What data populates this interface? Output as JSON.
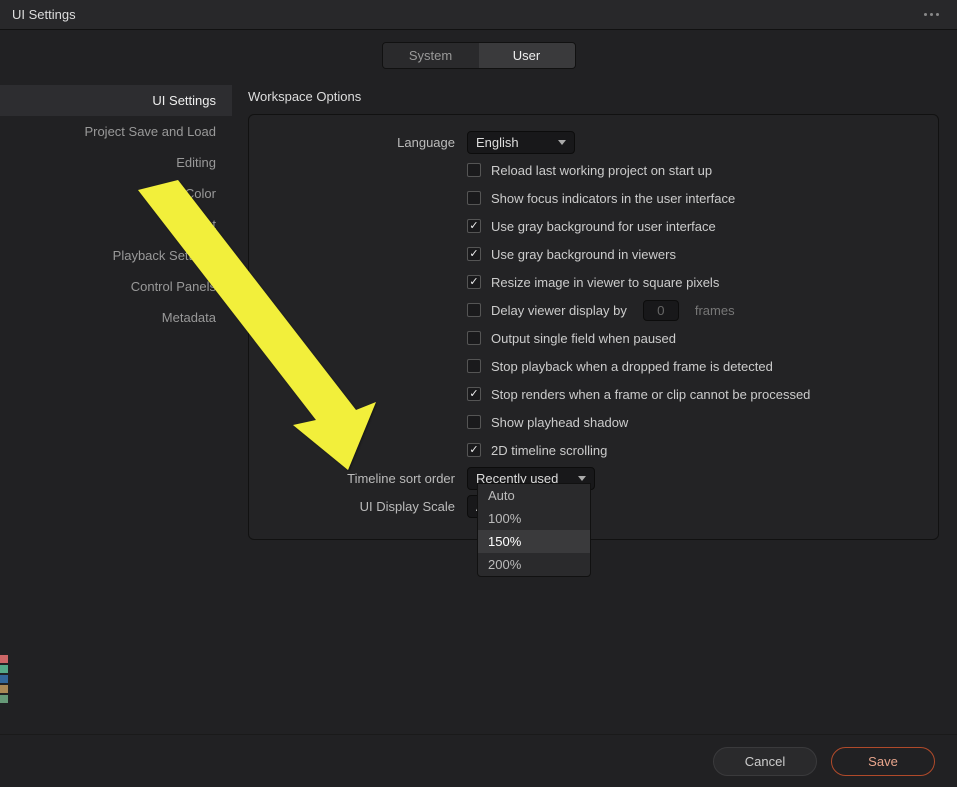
{
  "window_title": "UI Settings",
  "top_tabs": {
    "system": "System",
    "user": "User"
  },
  "sidebar": {
    "items": [
      "UI Settings",
      "Project Save and Load",
      "Editing",
      "Color",
      "Fairlight",
      "Playback Settings",
      "Control Panels",
      "Metadata"
    ]
  },
  "section_title": "Workspace Options",
  "rows": {
    "language_label": "Language",
    "language_value": "English",
    "cb_reload": "Reload last working project on start up",
    "cb_focus": "Show focus indicators in the user interface",
    "cb_gray_ui": "Use gray background for user interface",
    "cb_gray_viewers": "Use gray background in viewers",
    "cb_resize": "Resize image in viewer to square pixels",
    "cb_delay": "Delay viewer display by",
    "delay_value": "0",
    "delay_unit": "frames",
    "cb_output_single": "Output single field when paused",
    "cb_stop_playback": "Stop playback when a dropped frame is detected",
    "cb_stop_renders": "Stop renders when a frame or clip cannot be processed",
    "cb_playhead_shadow": "Show playhead shadow",
    "cb_2d_scroll": "2D timeline scrolling",
    "timeline_sort_label": "Timeline sort order",
    "timeline_sort_value": "Recently used",
    "ui_scale_label": "UI Display Scale",
    "ui_scale_value": "Auto"
  },
  "dropdown_options": [
    "Auto",
    "100%",
    "150%",
    "200%"
  ],
  "buttons": {
    "cancel": "Cancel",
    "save": "Save"
  }
}
